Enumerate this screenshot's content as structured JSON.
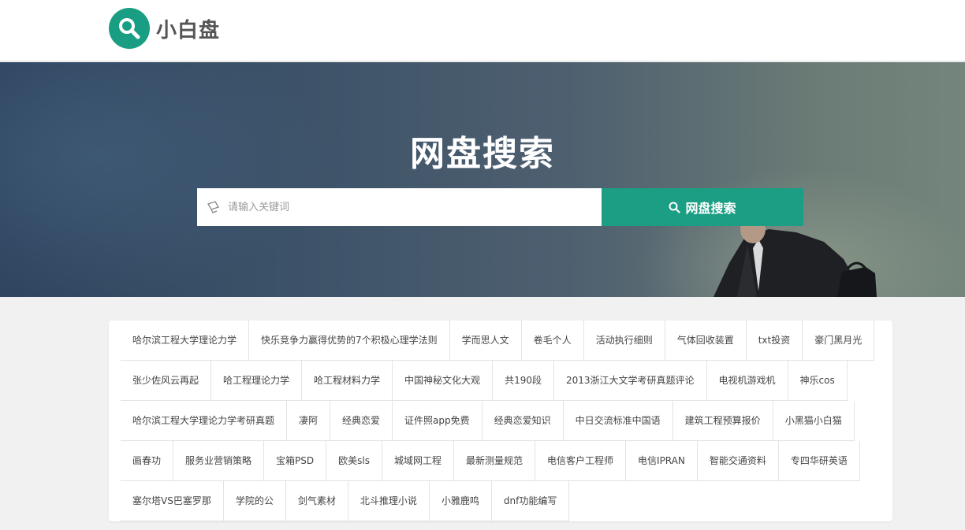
{
  "header": {
    "logo_text": "小白盘",
    "logo_icon": "search-icon",
    "brand_color": "#1a9e83"
  },
  "hero": {
    "title": "网盘搜索",
    "search_placeholder": "请输入关键词",
    "search_button_label": "网盘搜索"
  },
  "tags": [
    "哈尔滨工程大学理论力学",
    "快乐竞争力赢得优势的7个积极心理学法则",
    "学而思人文",
    "卷毛个人",
    "活动执行细则",
    "气体回收装置",
    "txt投资",
    "豪门黑月光",
    "张少佐风云再起",
    "哈工程理论力学",
    "哈工程材料力学",
    "中国神秘文化大观",
    "共190段",
    "2013浙江大文学考研真题评论",
    "电视机游戏机",
    "神乐cos",
    "哈尔滨工程大学理论力学考研真题",
    "凄阿",
    "经典恋爱",
    "证件照app免费",
    "经典恋爱知识",
    "中日交流标准中国语",
    "建筑工程预算报价",
    "小黑猫小白猫",
    "画春功",
    "服务业营销策略",
    "宝箱PSD",
    "欧美sls",
    "城域网工程",
    "最新测量规范",
    "电信客户工程师",
    "电信IPRAN",
    "智能交通资料",
    "专四华研英语",
    "塞尔塔VS巴塞罗那",
    "学院的公",
    "剑气素材",
    "北斗推理小说",
    "小雅鹿鸣",
    "dnf功能编写"
  ]
}
